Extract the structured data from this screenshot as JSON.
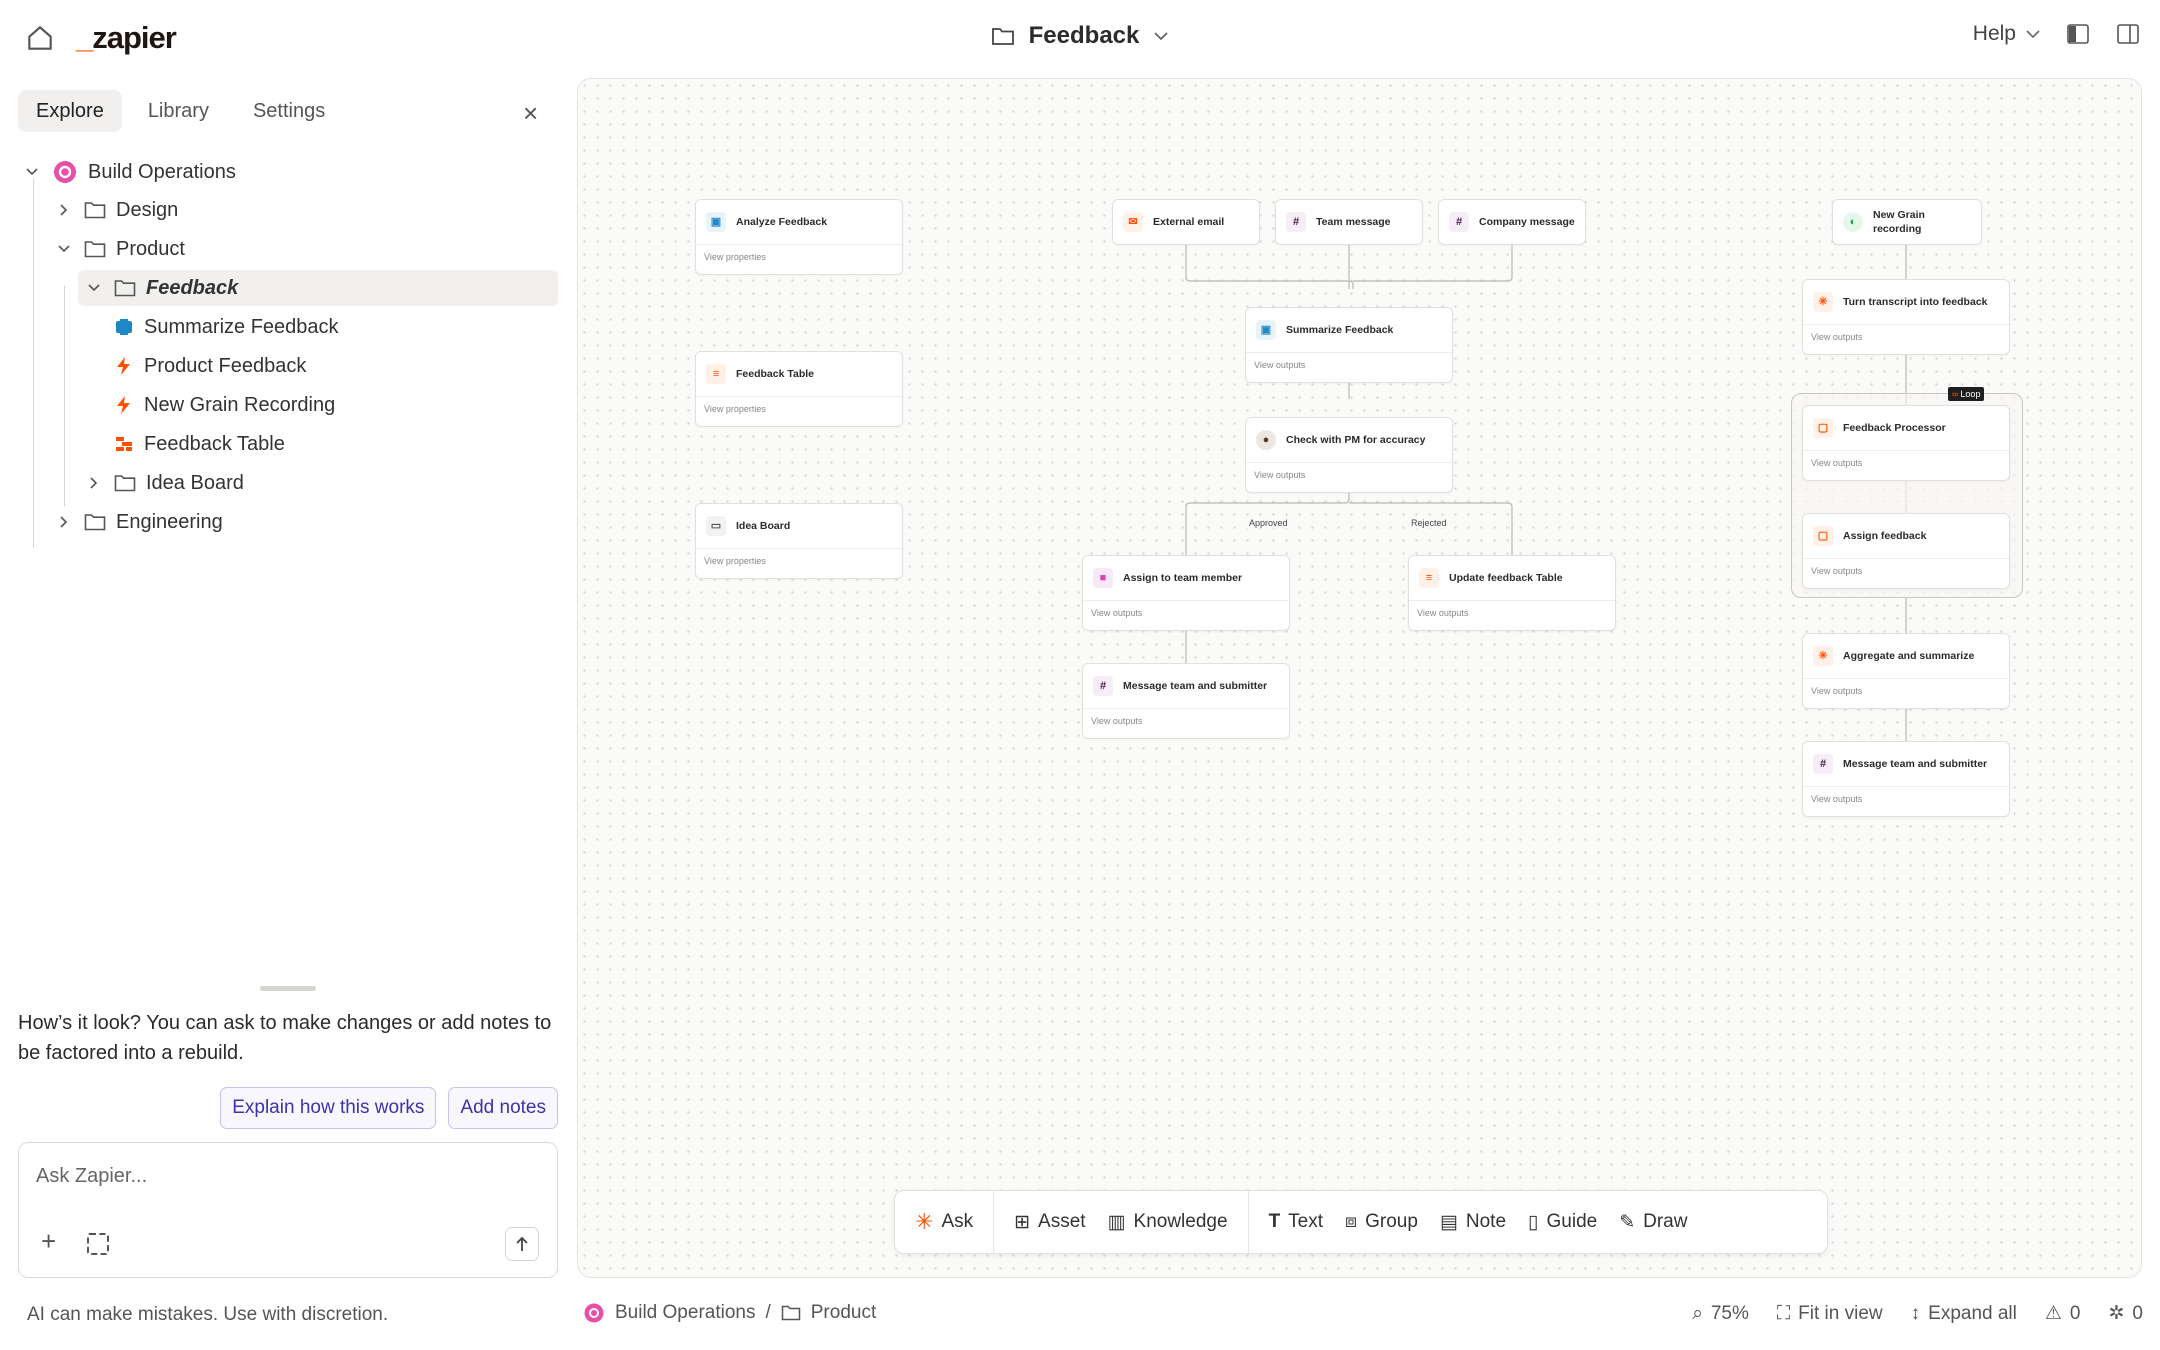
{
  "header": {
    "logo_text": "zapier",
    "page_title": "Feedback",
    "help_label": "Help"
  },
  "sidebar": {
    "tabs": [
      {
        "label": "Explore"
      },
      {
        "label": "Library"
      },
      {
        "label": "Settings"
      }
    ],
    "tree": {
      "root": "Build Operations",
      "design": "Design",
      "product": "Product",
      "feedback": "Feedback",
      "summarize": "Summarize Feedback",
      "product_feedback": "Product Feedback",
      "new_grain": "New Grain Recording",
      "feedback_table": "Feedback Table",
      "idea_board": "Idea Board",
      "engineering": "Engineering"
    }
  },
  "chat": {
    "message": "How’s it look? You can ask to make changes or add notes to be factored into a rebuild.",
    "chip_explain": "Explain how this works",
    "chip_notes": "Add notes",
    "input_placeholder": "Ask Zapier...",
    "disclaimer": "AI can make mistakes. Use with discretion."
  },
  "canvas": {
    "cards": {
      "analyze": {
        "title": "Analyze Feedback",
        "footer": "View properties"
      },
      "ftable": {
        "title": "Feedback Table",
        "footer": "View properties"
      },
      "idea": {
        "title": "Idea Board",
        "footer": "View properties"
      },
      "ext_email": {
        "title": "External email"
      },
      "team_msg": {
        "title": "Team message"
      },
      "company_msg": {
        "title": "Company message"
      },
      "summarize": {
        "title": "Summarize Feedback",
        "footer": "View outputs"
      },
      "check_pm": {
        "title": "Check with PM for accuracy",
        "footer": "View outputs"
      },
      "assign_member": {
        "title": "Assign to team member",
        "footer": "View outputs"
      },
      "update_table": {
        "title": "Update feedback Table",
        "footer": "View outputs"
      },
      "msg_team1": {
        "title": "Message team and submitter",
        "footer": "View outputs"
      },
      "new_grain": {
        "title": "New Grain recording"
      },
      "turn_transcript": {
        "title": "Turn transcript into feedback",
        "footer": "View outputs"
      },
      "processor": {
        "title": "Feedback Processor",
        "footer": "View outputs"
      },
      "assign_fb": {
        "title": "Assign feedback",
        "footer": "View outputs"
      },
      "aggregate": {
        "title": "Aggregate and summarize",
        "footer": "View outputs"
      },
      "msg_team2": {
        "title": "Message team and submitter",
        "footer": "View outputs"
      }
    },
    "edge_labels": {
      "approved": "Approved",
      "rejected": "Rejected"
    },
    "loop_label": "Loop"
  },
  "toolbar": {
    "ask": "Ask",
    "asset": "Asset",
    "knowledge": "Knowledge",
    "text": "Text",
    "group": "Group",
    "note": "Note",
    "guide": "Guide",
    "draw": "Draw"
  },
  "status": {
    "crumb_root": "Build Operations",
    "crumb_sep": "/",
    "crumb_folder": "Product",
    "zoom": "75%",
    "fit": "Fit in view",
    "expand": "Expand all",
    "warnings": "0",
    "bugs": "0"
  },
  "colors": {
    "brand": "#ff4f00",
    "chip_text": "#3d32a8",
    "slack": "#4a154b",
    "ai": "#1e88c7"
  }
}
